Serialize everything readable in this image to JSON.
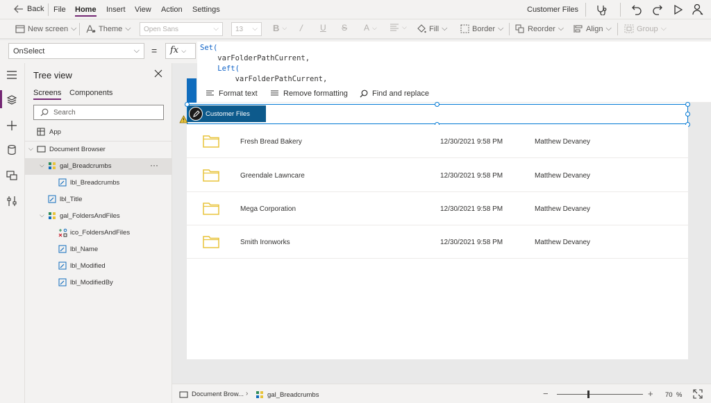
{
  "menubar": {
    "back": "Back",
    "items": [
      "File",
      "Home",
      "Insert",
      "View",
      "Action",
      "Settings"
    ],
    "app_title": "Customer Files"
  },
  "toolbar": {
    "new_screen": "New screen",
    "theme": "Theme",
    "font": "Open Sans",
    "font_size": "13",
    "fill": "Fill",
    "border": "Border",
    "reorder": "Reorder",
    "align": "Align",
    "group": "Group"
  },
  "formula": {
    "property": "OnSelect",
    "equals": "=",
    "fx": "fx",
    "lines": [
      "Set(",
      "    varFolderPathCurrent,",
      "    Left(",
      "        varFolderPathCurrent,"
    ]
  },
  "format_bar": {
    "format_text": "Format text",
    "remove_formatting": "Remove formatting",
    "find_replace": "Find and replace"
  },
  "tree": {
    "title": "Tree view",
    "tabs": [
      "Screens",
      "Components"
    ],
    "search_placeholder": "Search",
    "app": "App",
    "items": [
      {
        "label": "Document Browser"
      },
      {
        "label": "gal_Breadcrumbs",
        "more": "···"
      },
      {
        "label": "lbl_Breadcrumbs"
      },
      {
        "label": "lbl_Title"
      },
      {
        "label": "gal_FoldersAndFiles"
      },
      {
        "label": "ico_FoldersAndFiles"
      },
      {
        "label": "lbl_Name"
      },
      {
        "label": "lbl_Modified"
      },
      {
        "label": "lbl_ModifiedBy"
      }
    ]
  },
  "canvas": {
    "breadcrumb": "Customer Files",
    "rows": [
      {
        "name": "Fresh Bread Bakery",
        "modified": "12/30/2021 9:58 PM",
        "by": "Matthew Devaney"
      },
      {
        "name": "Greendale Lawncare",
        "modified": "12/30/2021 9:58 PM",
        "by": "Matthew Devaney"
      },
      {
        "name": "Mega Corporation",
        "modified": "12/30/2021 9:58 PM",
        "by": "Matthew Devaney"
      },
      {
        "name": "Smith Ironworks",
        "modified": "12/30/2021 9:58 PM",
        "by": "Matthew Devaney"
      }
    ]
  },
  "status": {
    "screen": "Document Brow...",
    "control": "gal_Breadcrumbs",
    "minus": "−",
    "plus": "+",
    "zoom": "70",
    "percent": "%"
  },
  "colors": {
    "accent": "#742774",
    "breadcrumb_bg": "#0d5a8c",
    "selection": "#0078d4",
    "folder": "#e8c33a"
  }
}
